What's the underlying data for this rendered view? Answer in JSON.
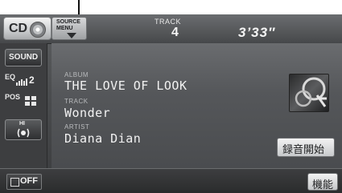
{
  "top_bar": {
    "source_label": "CD",
    "source_menu_label": "SOURCE\nMENU",
    "track_caption": "TRACK",
    "track_number": "4",
    "elapsed_time": "3’33″"
  },
  "side_panel": {
    "sound_label": "SOUND",
    "eq_caption": "EQ",
    "eq_value": "2",
    "pos_caption": "POS",
    "hi_label": "HI"
  },
  "info": {
    "album_caption": "ALBUM",
    "album": "THE LOVE OF LOOK",
    "track_caption": "TRACK",
    "track": "Wonder",
    "artist_caption": "ARTIST",
    "artist": "Diana Dian"
  },
  "buttons": {
    "record_start": "録音開始",
    "off": "OFF",
    "function": "機能"
  },
  "icons": {
    "disc": "cd-disc-icon",
    "menu_arrow": "chevron-down-icon",
    "eq_bars": "equalizer-icon",
    "seat": "seat-position-icon",
    "speaker": "speaker-icon",
    "album_art": "album-art-image"
  }
}
